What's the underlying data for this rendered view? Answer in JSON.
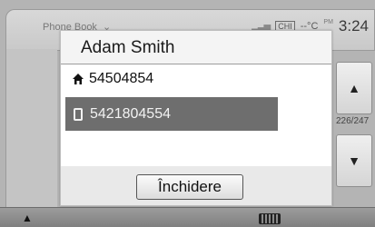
{
  "background": {
    "header_title": "Phone Book",
    "header_chevron": "chevron-down-icon",
    "status": {
      "signal_icon": "signal-icon",
      "battery_label": "CHI",
      "temperature": "--°C",
      "meridiem": "PM",
      "time": "3:24"
    },
    "page_count": "226/247",
    "scroll_up_icon": "triangle-up-icon",
    "scroll_down_icon": "triangle-down-icon",
    "home_icon": "home-icon",
    "keyboard_icon": "keyboard-icon"
  },
  "dialog": {
    "title": "Adam Smith",
    "entries": [
      {
        "type": "home",
        "icon": "house-icon",
        "number": "54504854"
      },
      {
        "type": "mobile",
        "icon": "mobile-phone-icon",
        "number": "5421804554",
        "selected": true
      }
    ],
    "close_label": "Închidere"
  },
  "colors": {
    "selected_row": "#6e6e6e",
    "dialog_bg": "#f4f4f4",
    "screen_bg": "#b4b4b4"
  }
}
